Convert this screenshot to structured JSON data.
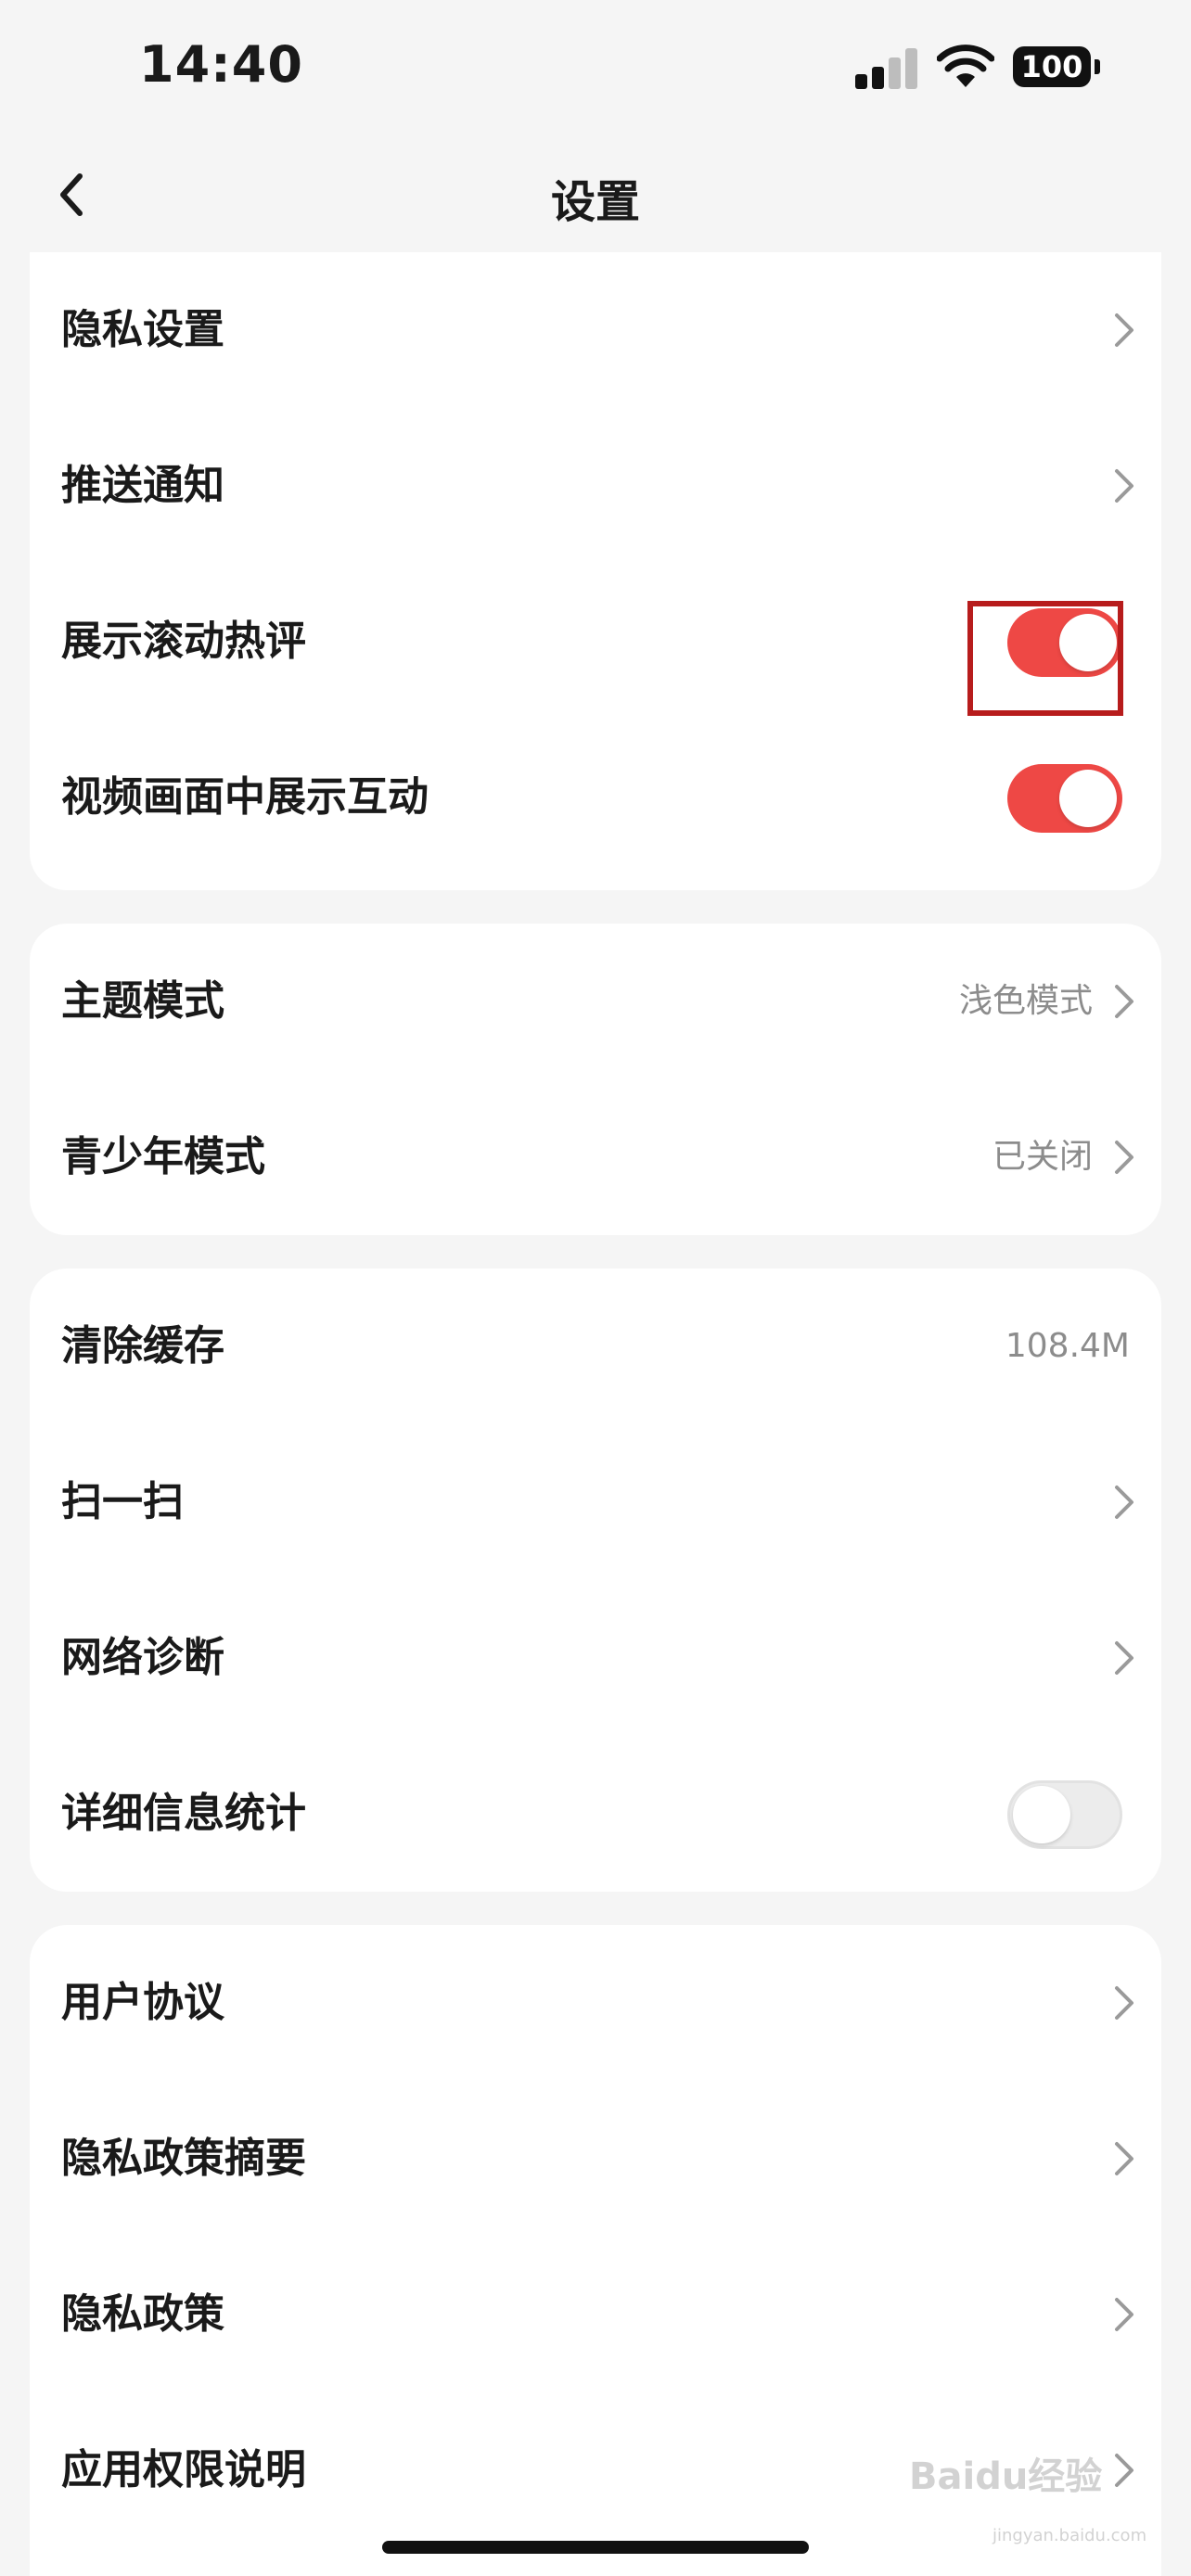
{
  "status": {
    "time": "14:40",
    "battery": "100"
  },
  "nav": {
    "title": "设置"
  },
  "groups": [
    {
      "items": [
        {
          "label": "隐私设置",
          "type": "chevron"
        },
        {
          "label": "推送通知",
          "type": "chevron"
        },
        {
          "label": "展示滚动热评",
          "type": "toggle",
          "on": true
        },
        {
          "label": "视频画面中展示互动",
          "type": "toggle",
          "on": true
        }
      ]
    },
    {
      "items": [
        {
          "label": "主题模式",
          "value": "浅色模式",
          "type": "chevron"
        },
        {
          "label": "青少年模式",
          "value": "已关闭",
          "type": "chevron"
        }
      ]
    },
    {
      "items": [
        {
          "label": "清除缓存",
          "value": "108.4M",
          "type": "value"
        },
        {
          "label": "扫一扫",
          "type": "chevron"
        },
        {
          "label": "网络诊断",
          "type": "chevron"
        },
        {
          "label": "详细信息统计",
          "type": "toggle",
          "on": false
        }
      ]
    },
    {
      "items": [
        {
          "label": "用户协议",
          "type": "chevron"
        },
        {
          "label": "隐私政策摘要",
          "type": "chevron"
        },
        {
          "label": "隐私政策",
          "type": "chevron"
        },
        {
          "label": "应用权限说明",
          "type": "chevron"
        }
      ]
    }
  ],
  "watermark": {
    "text": "Baidu经验",
    "sub": "jingyan.baidu.com"
  },
  "colors": {
    "accent": "#ee4845",
    "highlight": "#b71c1c",
    "background": "#f5f5f5"
  }
}
